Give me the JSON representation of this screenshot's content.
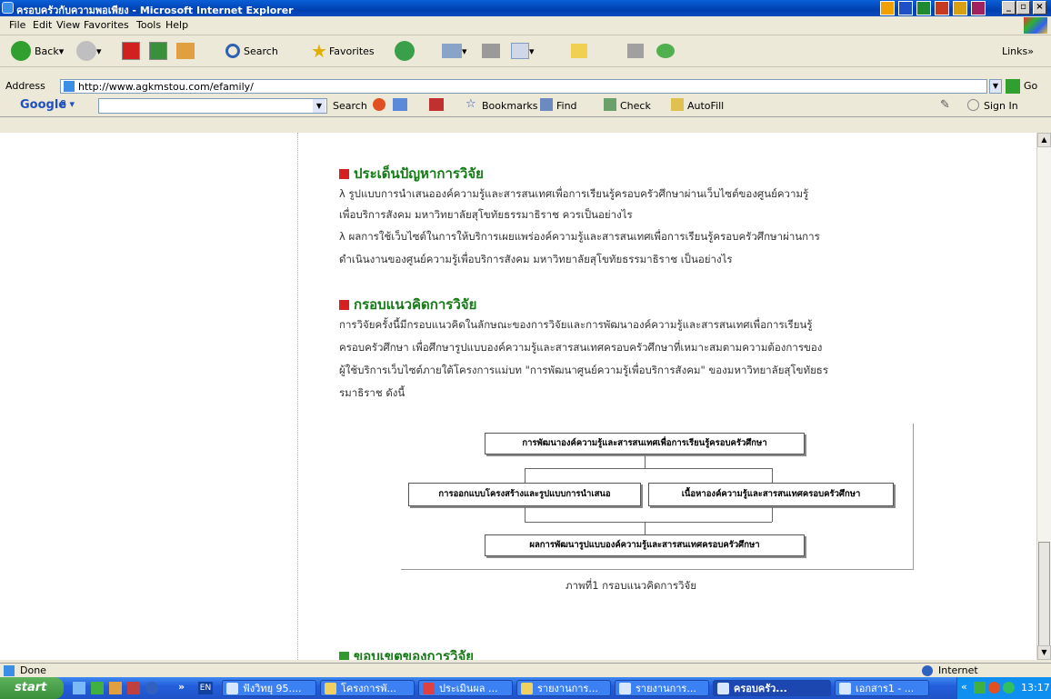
{
  "window": {
    "title": "ครอบครัวกับความพอเพียง - Microsoft Internet Explorer"
  },
  "menus": [
    "File",
    "Edit",
    "View",
    "Favorites",
    "Tools",
    "Help"
  ],
  "toolbar": {
    "back": "Back",
    "search": "Search",
    "favorites": "Favorites",
    "links": "Links"
  },
  "address": {
    "label": "Address",
    "url": "http://www.agkmstou.com/efamily/",
    "go": "Go"
  },
  "google": {
    "logo": "Google",
    "search": "Search",
    "bookmarks": "Bookmarks",
    "find": "Find",
    "check": "Check",
    "autofill": "AutoFill",
    "signin": "Sign In"
  },
  "content": {
    "section1": {
      "title": "ประเด็นปัญหาการวิจัย",
      "lines": [
        "λ  รูปแบบการนำเสนอองค์ความรู้และสารสนเทศเพื่อการเรียนรู้ครอบครัวศึกษาผ่านเว็บไซต์ของศูนย์ความรู้",
        "เพื่อบริการสังคม มหาวิทยาลัยสุโขทัยธรรมาธิราช ควรเป็นอย่างไร",
        "λ  ผลการใช้เว็บไซต์ในการให้บริการเผยแพร่องค์ความรู้และสารสนเทศเพื่อการเรียนรู้ครอบครัวศึกษาผ่านการ",
        "ดำเนินงานของศูนย์ความรู้เพื่อบริการสังคม มหาวิทยาลัยสุโขทัยธรรมาธิราช เป็นอย่างไร"
      ]
    },
    "section2": {
      "title": "กรอบแนวคิดการวิจัย",
      "lines": [
        "การวิจัยครั้งนี้มีกรอบแนวคิดในลักษณะของการวิจัยและการพัฒนาองค์ความรู้และสารสนเทศเพื่อการเรียนรู้",
        "ครอบครัวศึกษา เพื่อศึกษารูปแบบองค์ความรู้และสารสนเทศครอบครัวศึกษาที่เหมาะสมตามความต้องการของ",
        "ผู้ใช้บริการเว็บไซต์ภายใต้โครงการแม่บท \"การพัฒนาศูนย์ความรู้เพื่อบริการสังคม\" ของมหาวิทยาลัยสุโขทัยธร",
        "รมาธิราช ดังนี้"
      ]
    },
    "diagram": {
      "top": "การพัฒนาองค์ความรู้และสารสนเทศเพื่อการเรียนรู้ครอบครัวศึกษา",
      "left": "การออกแบบโครงสร้างและรูปแบบการนำเสนอ",
      "right": "เนื้อหาองค์ความรู้และสารสนเทศครอบครัวศึกษา",
      "bottom": "ผลการพัฒนารูปแบบองค์ความรู้และสารสนเทศครอบครัวศึกษา",
      "caption": "ภาพที่1 กรอบแนวคิดการวิจัย"
    },
    "section3": {
      "title": "ขอบเขตของการวิจัย"
    }
  },
  "status": {
    "text": "Done",
    "zone": "Internet"
  },
  "taskbar": {
    "start": "start",
    "lang": "EN",
    "tasks": [
      "ฟังวิทยุ 95....",
      "โครงการพั...",
      "ประเมินผล ...",
      "รายงานการ...",
      "รายงานการ...",
      "ครอบครัว...",
      "เอกสาร1 - ..."
    ],
    "clock": "13:17"
  },
  "colors": {
    "heading": "#137a15",
    "section_red": "#d42020",
    "section_green": "#2f9a2f"
  }
}
